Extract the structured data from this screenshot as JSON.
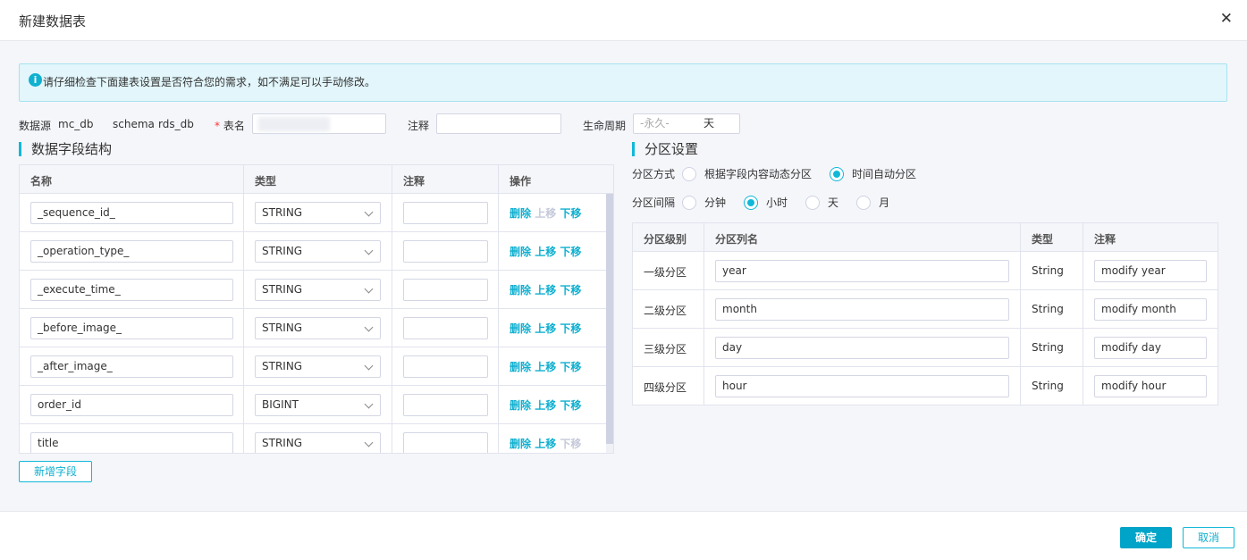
{
  "dialog": {
    "title": "新建数据表",
    "close_icon": "close-icon"
  },
  "alert": {
    "icon": "info-icon",
    "message": "请仔细检查下面建表设置是否符合您的需求，如不满足可以手动修改。"
  },
  "meta": {
    "datasource_label": "数据源",
    "datasource_value": "mc_db",
    "schema_label": "schema",
    "schema_value": "rds_db",
    "table_name_label": "表名",
    "table_name_value": "",
    "comment_label": "注释",
    "comment_value": "",
    "lifecycle_label": "生命周期",
    "lifecycle_placeholder": "-永久-",
    "lifecycle_unit": "天"
  },
  "fields": {
    "title": "数据字段结构",
    "columns": [
      "名称",
      "类型",
      "注释",
      "操作"
    ],
    "rows": [
      {
        "name": "_sequence_id_",
        "type": "STRING",
        "comment": "",
        "up_enabled": false,
        "down_enabled": true
      },
      {
        "name": "_operation_type_",
        "type": "STRING",
        "comment": "",
        "up_enabled": true,
        "down_enabled": true
      },
      {
        "name": "_execute_time_",
        "type": "STRING",
        "comment": "",
        "up_enabled": true,
        "down_enabled": true
      },
      {
        "name": "_before_image_",
        "type": "STRING",
        "comment": "",
        "up_enabled": true,
        "down_enabled": true
      },
      {
        "name": "_after_image_",
        "type": "STRING",
        "comment": "",
        "up_enabled": true,
        "down_enabled": true
      },
      {
        "name": "order_id",
        "type": "BIGINT",
        "comment": "",
        "up_enabled": true,
        "down_enabled": true
      },
      {
        "name": "title",
        "type": "STRING",
        "comment": "",
        "up_enabled": true,
        "down_enabled": false
      }
    ],
    "op_delete": "删除",
    "op_up": "上移",
    "op_down": "下移",
    "add_label": "新增字段"
  },
  "partition": {
    "title": "分区设置",
    "mode_label": "分区方式",
    "modes": [
      {
        "label": "根据字段内容动态分区",
        "selected": false
      },
      {
        "label": "时间自动分区",
        "selected": true
      }
    ],
    "interval_label": "分区间隔",
    "intervals": [
      {
        "label": "分钟",
        "selected": false
      },
      {
        "label": "小时",
        "selected": true
      },
      {
        "label": "天",
        "selected": false
      },
      {
        "label": "月",
        "selected": false
      }
    ],
    "columns": [
      "分区级别",
      "分区列名",
      "类型",
      "注释"
    ],
    "rows": [
      {
        "level": "一级分区",
        "name": "year",
        "type": "String",
        "comment": "modify year"
      },
      {
        "level": "二级分区",
        "name": "month",
        "type": "String",
        "comment": "modify month"
      },
      {
        "level": "三级分区",
        "name": "day",
        "type": "String",
        "comment": "modify day"
      },
      {
        "level": "四级分区",
        "name": "hour",
        "type": "String",
        "comment": "modify hour"
      }
    ]
  },
  "footer": {
    "ok_label": "确定",
    "cancel_label": "取消"
  },
  "colors": {
    "accent": "#10b8d8",
    "primary_button": "#00a4c8",
    "alert_bg": "#e2f6fb"
  }
}
